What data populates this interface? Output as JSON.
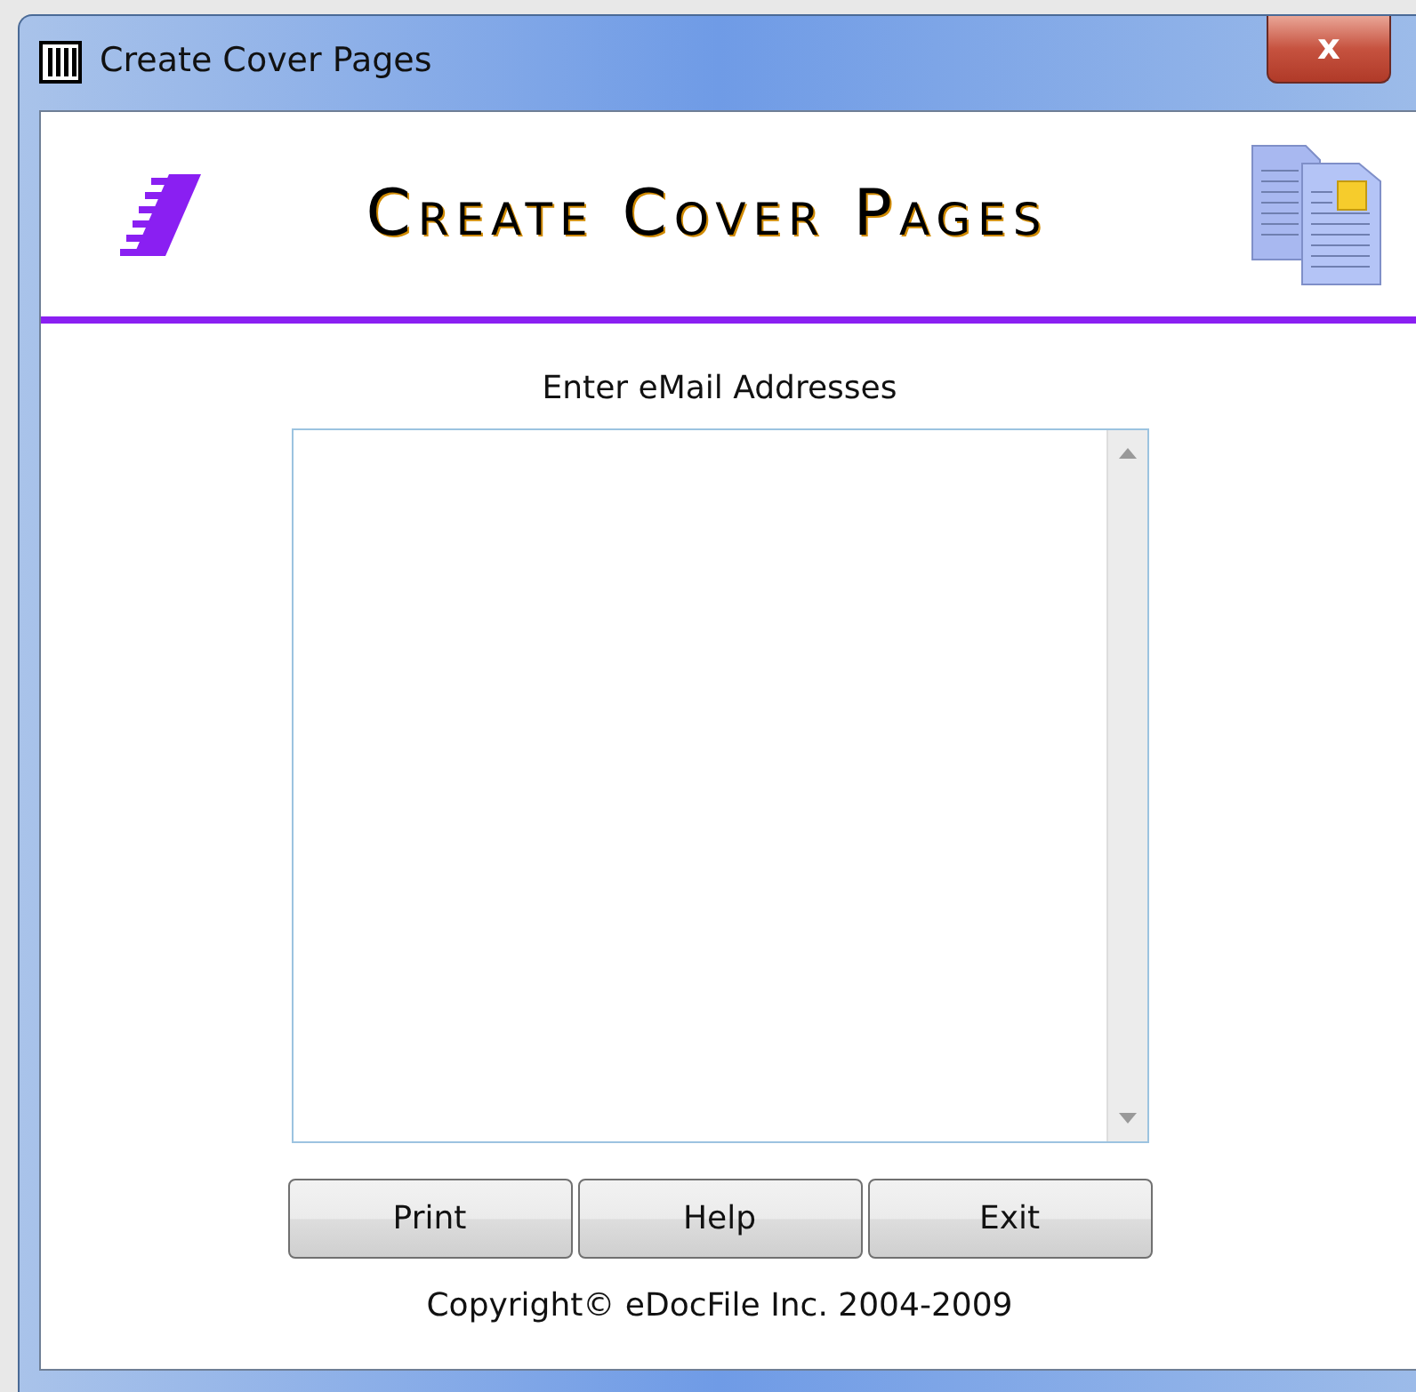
{
  "window": {
    "title": "Create Cover Pages",
    "close_label": "x"
  },
  "banner": {
    "title": "Create Cover Pages"
  },
  "form": {
    "label": "Enter eMail Addresses"
  },
  "buttons": [
    "Print",
    "Help",
    "Exit"
  ],
  "footer": {
    "copyright": "Copyright© eDocFile Inc. 2004-2009"
  }
}
